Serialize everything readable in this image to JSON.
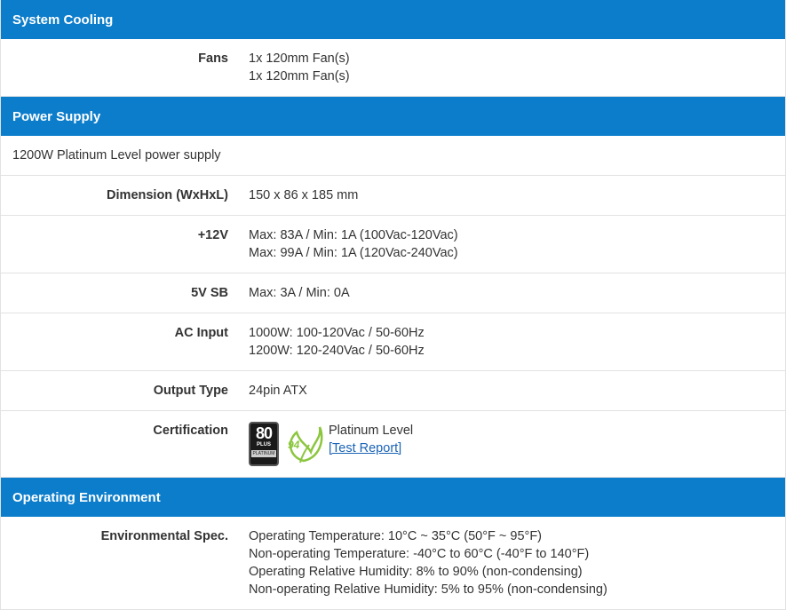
{
  "sections": {
    "system_cooling": {
      "title": "System Cooling",
      "fans_label": "Fans",
      "fans_values": [
        "1x 120mm Fan(s)",
        "1x 120mm Fan(s)"
      ]
    },
    "power_supply": {
      "title": "Power Supply",
      "description": "1200W Platinum Level power supply",
      "dimension_label": "Dimension (WxHxL)",
      "dimension_value": "150 x 86 x 185 mm",
      "v12_label": "+12V",
      "v12_values": [
        "Max: 83A / Min: 1A (100Vac-120Vac)",
        "Max: 99A / Min: 1A (120Vac-240Vac)"
      ],
      "v5sb_label": "5V SB",
      "v5sb_value": "Max: 3A / Min: 0A",
      "ac_label": "AC Input",
      "ac_values": [
        "1000W: 100-120Vac / 50-60Hz",
        "1200W: 120-240Vac / 50-60Hz"
      ],
      "output_label": "Output Type",
      "output_value": "24pin ATX",
      "cert_label": "Certification",
      "cert_level": "Platinum Level",
      "cert_link": "[Test Report]",
      "badge_number": "80",
      "badge_plus": "PLUS",
      "badge_tier": "PLATINUM",
      "eco_number": "94"
    },
    "operating_environment": {
      "title": "Operating Environment",
      "env_label": "Environmental Spec.",
      "env_values": [
        "Operating Temperature: 10°C ~ 35°C (50°F ~ 95°F)",
        "Non-operating Temperature: -40°C to 60°C (-40°F to 140°F)",
        "Operating Relative Humidity: 8% to 90% (non-condensing)",
        "Non-operating Relative Humidity: 5% to 95% (non-condensing)"
      ]
    }
  },
  "colors": {
    "header_bg": "#0c7dcb",
    "border": "#e2e2e2",
    "link": "#1a63b5",
    "eco_green": "#8cc63f"
  }
}
